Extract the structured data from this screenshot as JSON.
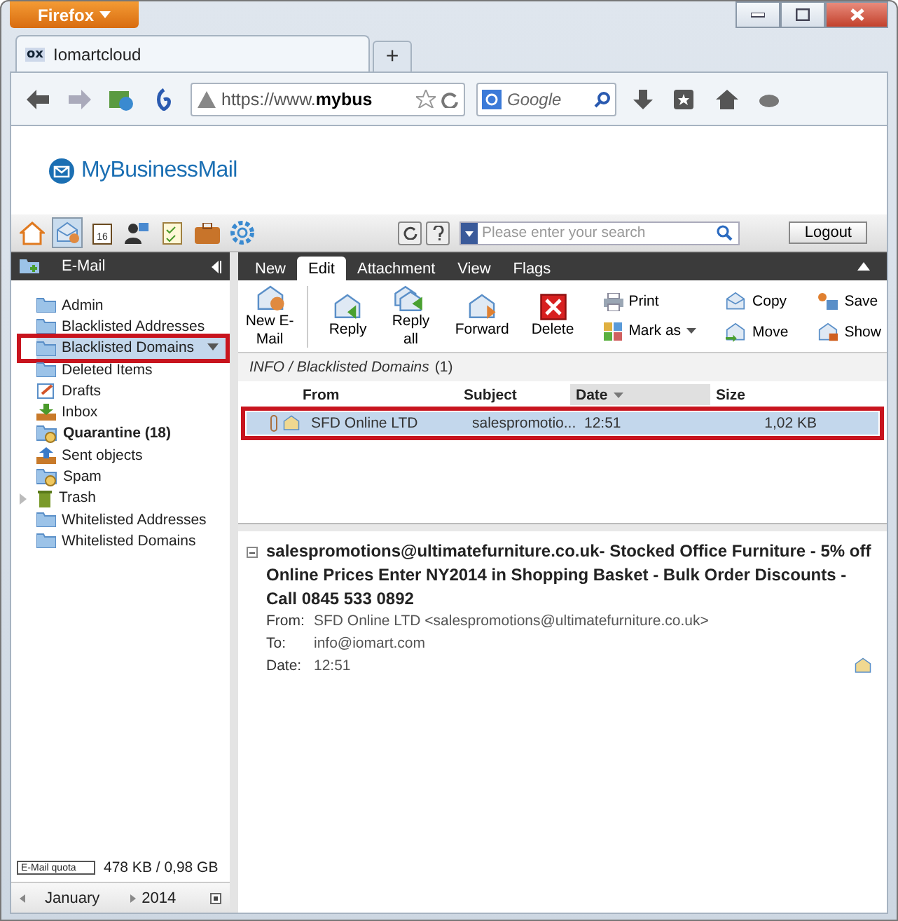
{
  "browser": {
    "menu_button": "Firefox",
    "favicon": "ox",
    "tab_title": "Iomartcloud",
    "new_tab": "+",
    "url_prefix": "https://www.",
    "url_bold": "mybus",
    "search_placeholder": "Google"
  },
  "app": {
    "logo": "MyBusinessMail",
    "calendar_day": "16",
    "search_placeholder": "Please enter your search",
    "logout": "Logout"
  },
  "sidebar": {
    "title": "E-Mail",
    "folders": [
      {
        "name": "Admin",
        "kind": "folder",
        "selected": false,
        "bold": false,
        "highlighted": false,
        "has_children": false
      },
      {
        "name": "Blacklisted Addresses",
        "kind": "folder",
        "selected": false,
        "bold": false,
        "highlighted": false,
        "has_children": false
      },
      {
        "name": "Blacklisted Domains",
        "kind": "folder",
        "selected": true,
        "bold": false,
        "highlighted": true,
        "has_children": false
      },
      {
        "name": "Deleted Items",
        "kind": "folder",
        "selected": false,
        "bold": false,
        "highlighted": false,
        "has_children": false
      },
      {
        "name": "Drafts",
        "kind": "drafts",
        "selected": false,
        "bold": false,
        "highlighted": false,
        "has_children": false
      },
      {
        "name": "Inbox",
        "kind": "inbox",
        "selected": false,
        "bold": false,
        "highlighted": false,
        "has_children": false
      },
      {
        "name": "Quarantine (18)",
        "kind": "special",
        "selected": false,
        "bold": true,
        "highlighted": false,
        "has_children": false
      },
      {
        "name": "Sent objects",
        "kind": "sent",
        "selected": false,
        "bold": false,
        "highlighted": false,
        "has_children": false
      },
      {
        "name": "Spam",
        "kind": "special",
        "selected": false,
        "bold": false,
        "highlighted": false,
        "has_children": false
      },
      {
        "name": "Trash",
        "kind": "trash",
        "selected": false,
        "bold": false,
        "highlighted": false,
        "has_children": true
      },
      {
        "name": "Whitelisted Addresses",
        "kind": "folder",
        "selected": false,
        "bold": false,
        "highlighted": false,
        "has_children": false
      },
      {
        "name": "Whitelisted Domains",
        "kind": "folder",
        "selected": false,
        "bold": false,
        "highlighted": false,
        "has_children": false
      }
    ],
    "quota": {
      "label": "E-Mail quota",
      "reading": "478 KB / 0,98 GB"
    },
    "month": "January",
    "year": "2014"
  },
  "ribbon": {
    "tabs": [
      {
        "label": "New",
        "selected": false
      },
      {
        "label": "Edit",
        "selected": true
      },
      {
        "label": "Attachment",
        "selected": false
      },
      {
        "label": "View",
        "selected": false
      },
      {
        "label": "Flags",
        "selected": false
      }
    ],
    "large_actions": [
      {
        "label": "New E-Mail",
        "kind": "new"
      },
      {
        "label": "Reply",
        "kind": "reply"
      },
      {
        "label": "Reply all",
        "kind": "replyall"
      },
      {
        "label": "Forward",
        "kind": "forward"
      },
      {
        "label": "Delete",
        "kind": "delete"
      }
    ],
    "small_actions": [
      {
        "label": "Print",
        "kind": "print"
      },
      {
        "label": "Mark as",
        "kind": "mark"
      },
      {
        "label": "Copy",
        "kind": "copy"
      },
      {
        "label": "Move",
        "kind": "move"
      },
      {
        "label": "Save",
        "kind": "save"
      },
      {
        "label": "Show",
        "kind": "show"
      }
    ]
  },
  "list": {
    "path": "INFO / Blacklisted Domains",
    "count": "(1)",
    "columns": [
      {
        "label": "From",
        "sorted": false
      },
      {
        "label": "Subject",
        "sorted": false
      },
      {
        "label": "Date",
        "sorted": true
      },
      {
        "label": "Size",
        "sorted": false
      }
    ],
    "rows": [
      {
        "from": "SFD Online LTD",
        "subject": "salespromotio...",
        "date": "12:51",
        "size": "1,02 KB",
        "selected": true,
        "highlighted": true,
        "attachment": true
      }
    ]
  },
  "preview": {
    "subject": "salespromotions@ultimatefurniture.co.uk- Stocked Office Furniture - 5% off Online Prices Enter NY2014 in Shopping Basket - Bulk Order Discounts - Call 0845 533 0892",
    "fields": [
      {
        "label": "From:",
        "value": "SFD Online LTD <salespromotions@ultimatefurniture.co.uk>"
      },
      {
        "label": "To:",
        "value": "info@iomart.com"
      },
      {
        "label": "Date:",
        "value": "12:51"
      }
    ]
  }
}
